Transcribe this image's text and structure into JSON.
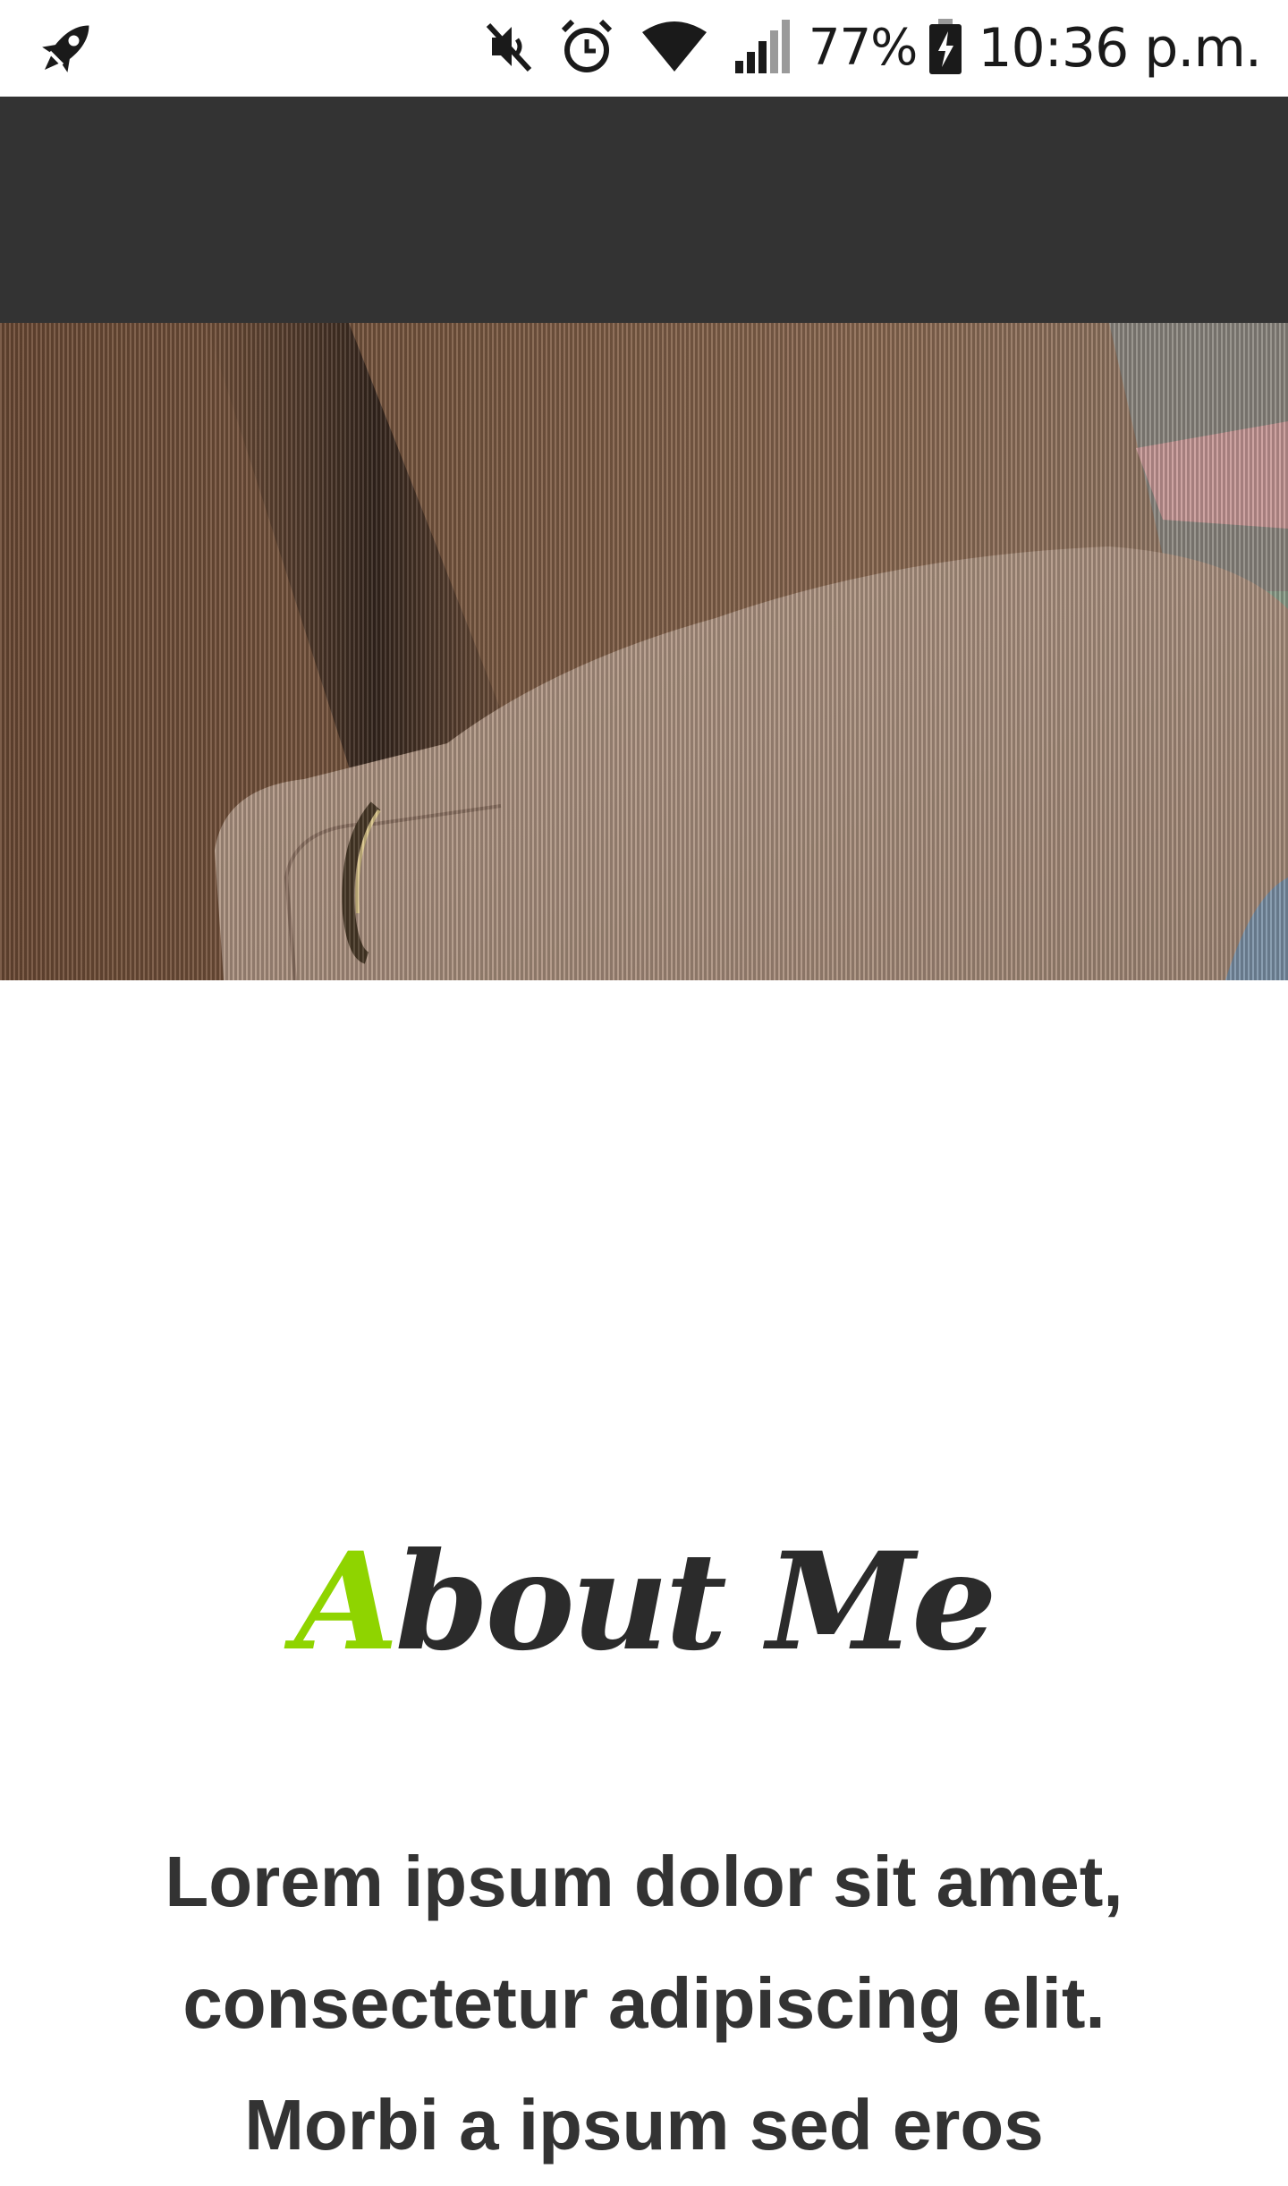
{
  "status_bar": {
    "app_icon": "rocket-icon",
    "icons": [
      "mute-icon",
      "alarm-icon",
      "wifi-icon",
      "signal-icon"
    ],
    "battery_percent": "77%",
    "battery_icon": "battery-charging-icon",
    "time": "10:36 p.m."
  },
  "header": {
    "background_color": "#333333"
  },
  "hero": {
    "image": "hand-with-ring-photo"
  },
  "about": {
    "title_accent": "A",
    "title_rest": "bout Me",
    "accent_color": "#8fd400",
    "text": "Lorem ipsum dolor sit amet, consectetur adipiscing elit. Morbi a ipsum sed eros"
  }
}
